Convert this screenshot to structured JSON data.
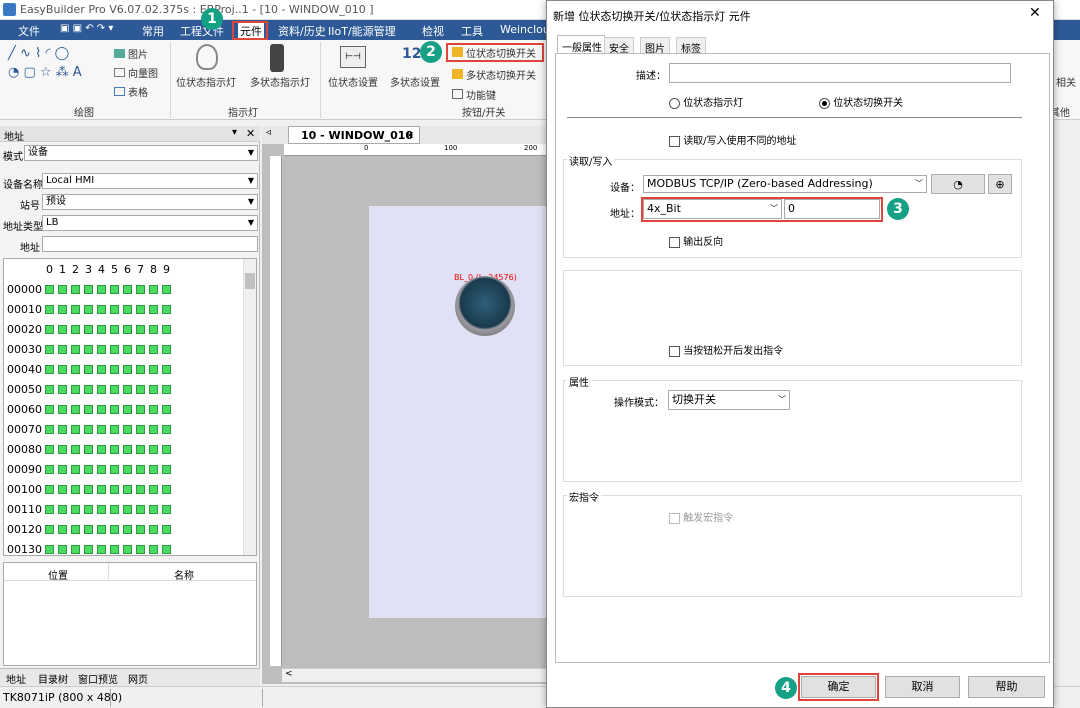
{
  "titlebar": {
    "title": "EasyBuilder Pro V6.07.02.375s : EBProj..1 - [10 - WINDOW_010 ]"
  },
  "menu": {
    "items": [
      "文件",
      "常用",
      "工程文件",
      "元件",
      "资料/历史",
      "IIoT/能源管理",
      "检视",
      "工具",
      "Weinclou"
    ]
  },
  "ribbon": {
    "draw_group": "绘图",
    "draw_items": {
      "picture": "图片",
      "vector": "向量图",
      "table": "表格"
    },
    "indicator_group": "指示灯",
    "indicator_items": [
      "位状态指示灯",
      "多状态指示灯"
    ],
    "switch_group": "按钮/开关",
    "switch_items": [
      "位状态设置",
      "多状态设置"
    ],
    "switch_list": [
      "位状态切换开关",
      "多状态切换开关",
      "功能键"
    ],
    "right_label": "相关",
    "right_label2": "其他"
  },
  "left_panel": {
    "title": "地址",
    "mode_label": "模式",
    "mode_value": "设备",
    "device_label": "设备名称",
    "device_value": "Local HMI",
    "station_label": "站号",
    "station_value": "预设",
    "addr_type_label": "地址类型",
    "addr_type_value": "LB",
    "addr_label": "地址",
    "columns": [
      "0",
      "1",
      "2",
      "3",
      "4",
      "5",
      "6",
      "7",
      "8",
      "9"
    ],
    "rows": [
      "00000",
      "00010",
      "00020",
      "00030",
      "00040",
      "00050",
      "00060",
      "00070",
      "00080",
      "00090",
      "00100",
      "00110",
      "00120",
      "00130"
    ],
    "list_headers": [
      "位置",
      "名称"
    ],
    "bottom_tabs": [
      "地址",
      "目录树",
      "窗口预览",
      "网页"
    ]
  },
  "canvas": {
    "doc_tab": "10 - WINDOW_010",
    "ruler_labels": [
      "0",
      "100",
      "200"
    ],
    "object_label": "BL_0 (L. 24576)"
  },
  "status": {
    "device": "TK8071iP (800 x 480)"
  },
  "dialog": {
    "title": "新增 位状态切换开关/位状态指示灯 元件",
    "tabs": [
      "一般属性",
      "安全",
      "图片",
      "标签"
    ],
    "desc_label": "描述：",
    "desc_value": "",
    "radio_indicator": "位状态指示灯",
    "radio_switch": "位状态切换开关",
    "rw_diff_label": "读取/写入使用不同的地址",
    "rw_group": "读取/写入",
    "device_label": "设备：",
    "device_value": "MODBUS TCP/IP (Zero-based Addressing)",
    "addr_label": "地址：",
    "addr_type_value": "4x_Bit",
    "addr_value": "0",
    "invert_label": "输出反向",
    "release_label": "当按钮松开后发出指令",
    "prop_group": "属性",
    "op_mode_label": "操作模式：",
    "op_mode_value": "切换开关",
    "macro_group": "宏指令",
    "macro_label": "触发宏指令",
    "ok": "确定",
    "cancel": "取消",
    "help": "帮助"
  },
  "badges": [
    "1",
    "2",
    "3",
    "4"
  ],
  "colors": {
    "accent": "#2d5a96",
    "badge": "#16a085",
    "highlight": "#e0453a",
    "cell": "#4cd964"
  }
}
